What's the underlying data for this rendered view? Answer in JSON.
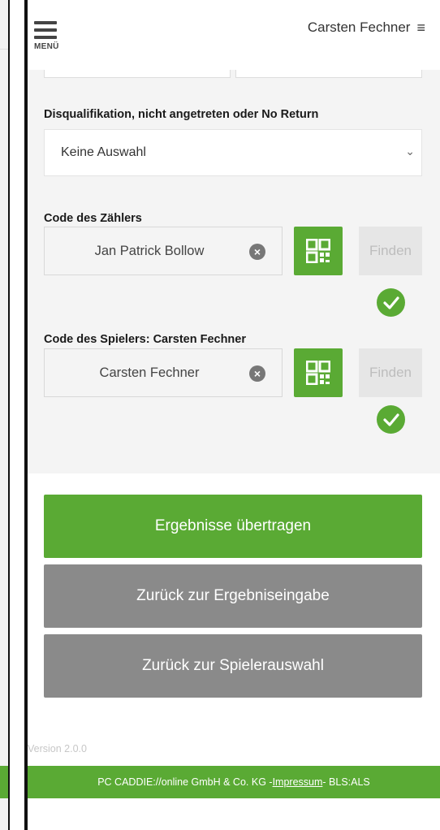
{
  "header": {
    "menu_label": "MENÜ",
    "user_name": "Carsten Fechner"
  },
  "disq": {
    "label": "Disqualifikation, nicht angetreten oder No Return",
    "selected": "Keine Auswahl"
  },
  "counter": {
    "label": "Code des Zählers",
    "value": "Jan Patrick Bollow",
    "find_label": "Finden"
  },
  "player": {
    "label": "Code des Spielers: Carsten Fechner",
    "value": "Carsten Fechner",
    "find_label": "Finden"
  },
  "actions": {
    "submit": "Ergebnisse übertragen",
    "back_entry": "Zurück zur Ergebniseingabe",
    "back_player": "Zurück zur Spielerauswahl"
  },
  "version": "Version 2.0.0",
  "footer": {
    "company": "PC CADDIE://online GmbH & Co. KG - ",
    "impressum": "Impressum",
    "suffix": " - BLS:ALS"
  },
  "colors": {
    "primary": "#5aaa34",
    "secondary_button": "#8a8a8a",
    "disabled_button": "#e6e6e6"
  }
}
